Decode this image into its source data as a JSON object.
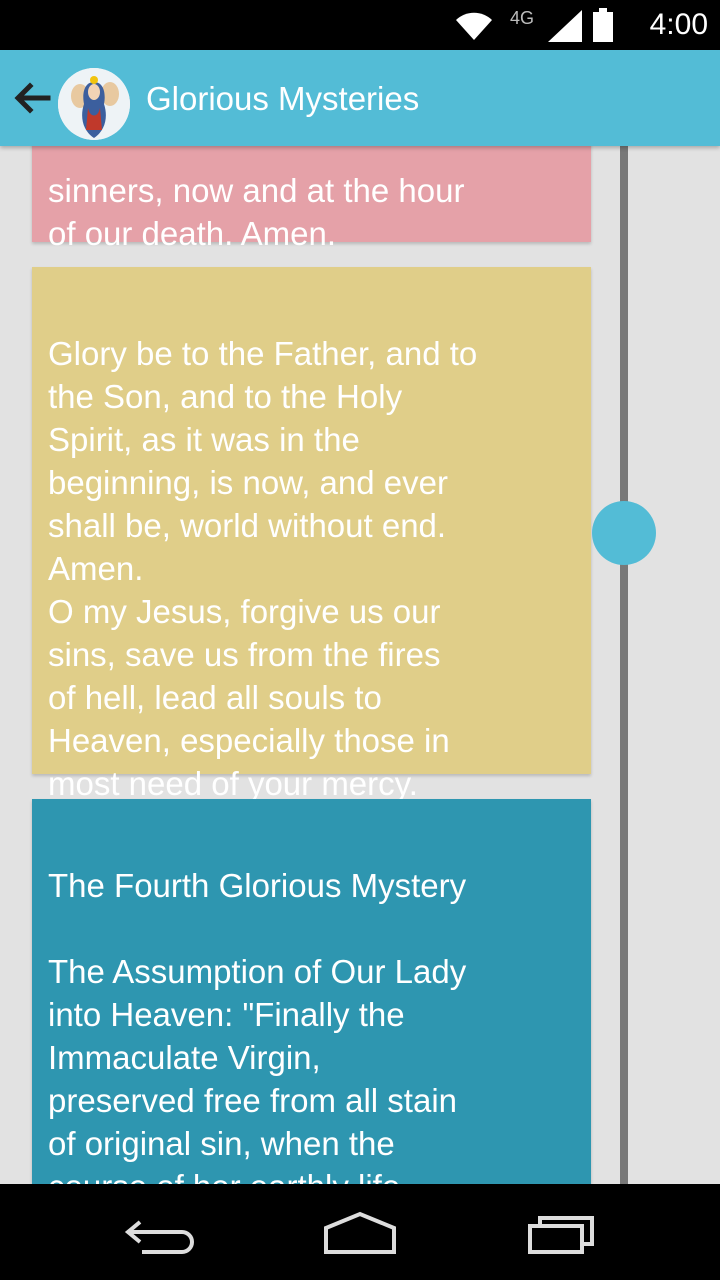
{
  "status_bar": {
    "time": "4:00",
    "network_label": "4G",
    "icons": [
      "wifi-icon",
      "signal-icon",
      "battery-icon"
    ]
  },
  "app_bar": {
    "title": "Glorious Mysteries",
    "back_icon": "arrow-left-icon",
    "avatar": "avatar"
  },
  "cards": [
    {
      "text": "sinners, now and at the hour\nof our death. Amen.",
      "color": "#e5a1a8"
    },
    {
      "text": "Glory be to the Father, and to\nthe Son, and to the Holy\nSpirit, as it was in the\nbeginning, is now, and ever\nshall be, world without end.\nAmen.\nO my Jesus, forgive us our\nsins, save us from the fires\nof hell, lead all souls to\nHeaven, especially those in\nmost need of your mercy.",
      "color": "#e0ce89"
    },
    {
      "text": "The Fourth Glorious Mystery\n\nThe Assumption of Our Lady\ninto Heaven: \"Finally the\nImmaculate Virgin,\npreserved free from all stain\nof original sin, when the\ncourse of her earthly life\nwas finished, was taken up",
      "color": "#2e96b0"
    }
  ],
  "colors": {
    "accent": "#53bcd6",
    "pink_card": "#e5a1a8",
    "yellow_card": "#e0ce89",
    "blue_card": "#2e96b0",
    "background": "#e2e2e2"
  },
  "nav_bar": {
    "buttons": [
      "back-nav-icon",
      "home-nav-icon",
      "recents-nav-icon"
    ]
  }
}
